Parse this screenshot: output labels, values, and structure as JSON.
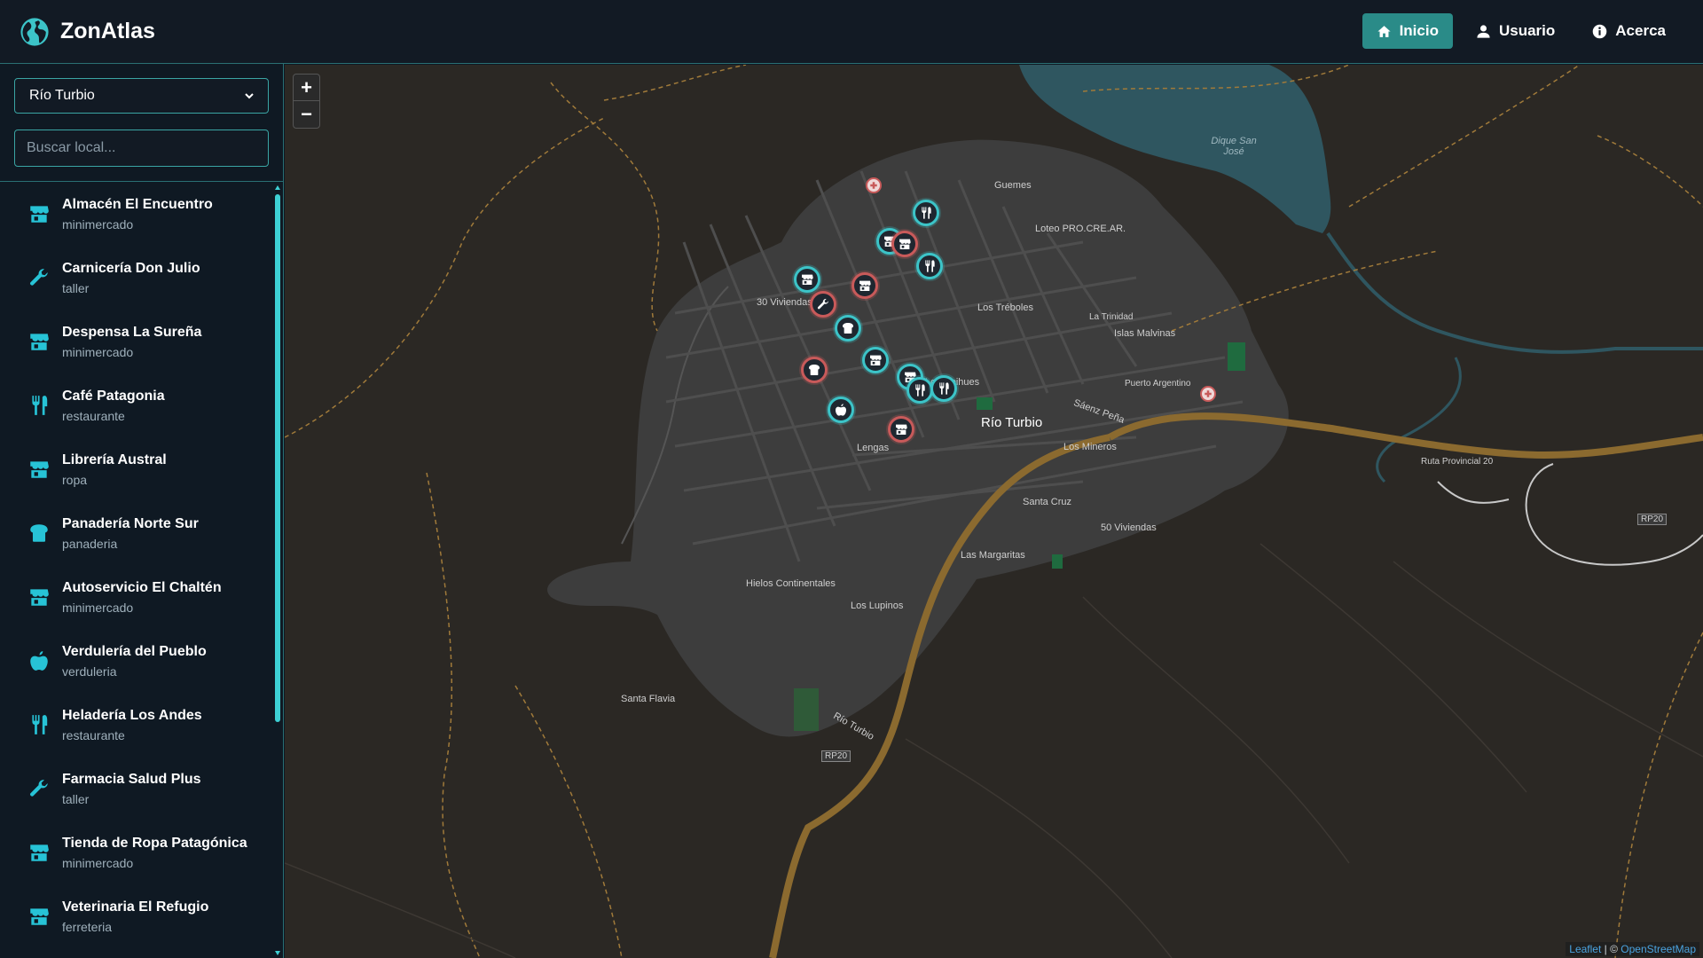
{
  "app": {
    "title": "ZonAtlas"
  },
  "nav": [
    {
      "label": "Inicio",
      "icon": "home-icon",
      "active": true
    },
    {
      "label": "Usuario",
      "icon": "user-icon",
      "active": false
    },
    {
      "label": "Acerca",
      "icon": "info-icon",
      "active": false
    }
  ],
  "sidebar": {
    "city_select": {
      "value": "Río Turbio"
    },
    "search": {
      "placeholder": "Buscar local..."
    },
    "items": [
      {
        "name": "Almacén El Encuentro",
        "category": "minimercado",
        "icon": "store-icon"
      },
      {
        "name": "Carnicería Don Julio",
        "category": "taller",
        "icon": "wrench-icon"
      },
      {
        "name": "Despensa La Sureña",
        "category": "minimercado",
        "icon": "store-icon"
      },
      {
        "name": "Café Patagonia",
        "category": "restaurante",
        "icon": "utensils-icon"
      },
      {
        "name": "Librería Austral",
        "category": "ropa",
        "icon": "store-icon"
      },
      {
        "name": "Panadería Norte Sur",
        "category": "panaderia",
        "icon": "bread-icon"
      },
      {
        "name": "Autoservicio El Chaltén",
        "category": "minimercado",
        "icon": "store-icon"
      },
      {
        "name": "Verdulería del Pueblo",
        "category": "verduleria",
        "icon": "apple-icon"
      },
      {
        "name": "Heladería Los Andes",
        "category": "restaurante",
        "icon": "utensils-icon"
      },
      {
        "name": "Farmacia Salud Plus",
        "category": "taller",
        "icon": "wrench-icon"
      },
      {
        "name": "Tienda de Ropa Patagónica",
        "category": "minimercado",
        "icon": "store-icon"
      },
      {
        "name": "Veterinaria El Refugio",
        "category": "ferreteria",
        "icon": "store-icon"
      }
    ]
  },
  "map": {
    "zoom_in": "+",
    "zoom_out": "−",
    "attribution": {
      "leaflet": "Leaflet",
      "separator": " | © ",
      "osm": "OpenStreetMap"
    },
    "labels": {
      "city": "Río Turbio",
      "dique": "Dique San José",
      "los_treboles": "Los Tréboles",
      "islas_malvinas": "Islas Malvinas",
      "los_coihues": "Los Coihues",
      "loteo": "Loteo PRO.CRE.AR.",
      "guemes": "Guemes",
      "viviendas30": "30 Viviendas",
      "los_mineros": "Los Mineros",
      "santa_cruz": "Santa Cruz",
      "viviendas50": "50 Viviendas",
      "las_margaritas": "Las Margaritas",
      "los_lupinos": "Los Lupinos",
      "hielos": "Hielos Continentales",
      "santa_flavia": "Santa Flavia",
      "ruta20": "Ruta Provincial 20",
      "rp20a": "RP20",
      "rp20b": "RP20",
      "saenz": "Sáenz Peña",
      "lengas": "Lengas",
      "puerto_argentino": "Puerto Argentino",
      "la_trinidad": "La Trinidad",
      "rio_turbio_road": "Río Turbio"
    },
    "markers": [
      {
        "icon": "utensils-icon",
        "color": "teal"
      },
      {
        "icon": "store-icon",
        "color": "teal"
      },
      {
        "icon": "store-icon",
        "color": "red"
      },
      {
        "icon": "utensils-icon",
        "color": "teal"
      },
      {
        "icon": "store-icon",
        "color": "teal"
      },
      {
        "icon": "store-icon",
        "color": "red"
      },
      {
        "icon": "wrench-icon",
        "color": "red"
      },
      {
        "icon": "bread-icon",
        "color": "teal"
      },
      {
        "icon": "store-icon",
        "color": "teal"
      },
      {
        "icon": "bread-icon",
        "color": "red"
      },
      {
        "icon": "store-icon",
        "color": "teal"
      },
      {
        "icon": "utensils-icon",
        "color": "teal"
      },
      {
        "icon": "utensils-icon",
        "color": "teal"
      },
      {
        "icon": "apple-icon",
        "color": "teal"
      },
      {
        "icon": "store-icon",
        "color": "red"
      },
      {
        "icon": "store-icon",
        "color": "teal"
      },
      {
        "icon": "medical-icon",
        "color": "red"
      },
      {
        "icon": "medical-icon",
        "color": "red"
      }
    ],
    "colors": {
      "accent": "#3cc4c8",
      "danger": "#c85a5a",
      "water": "#2f5660",
      "road": "#8b6a2f"
    }
  }
}
